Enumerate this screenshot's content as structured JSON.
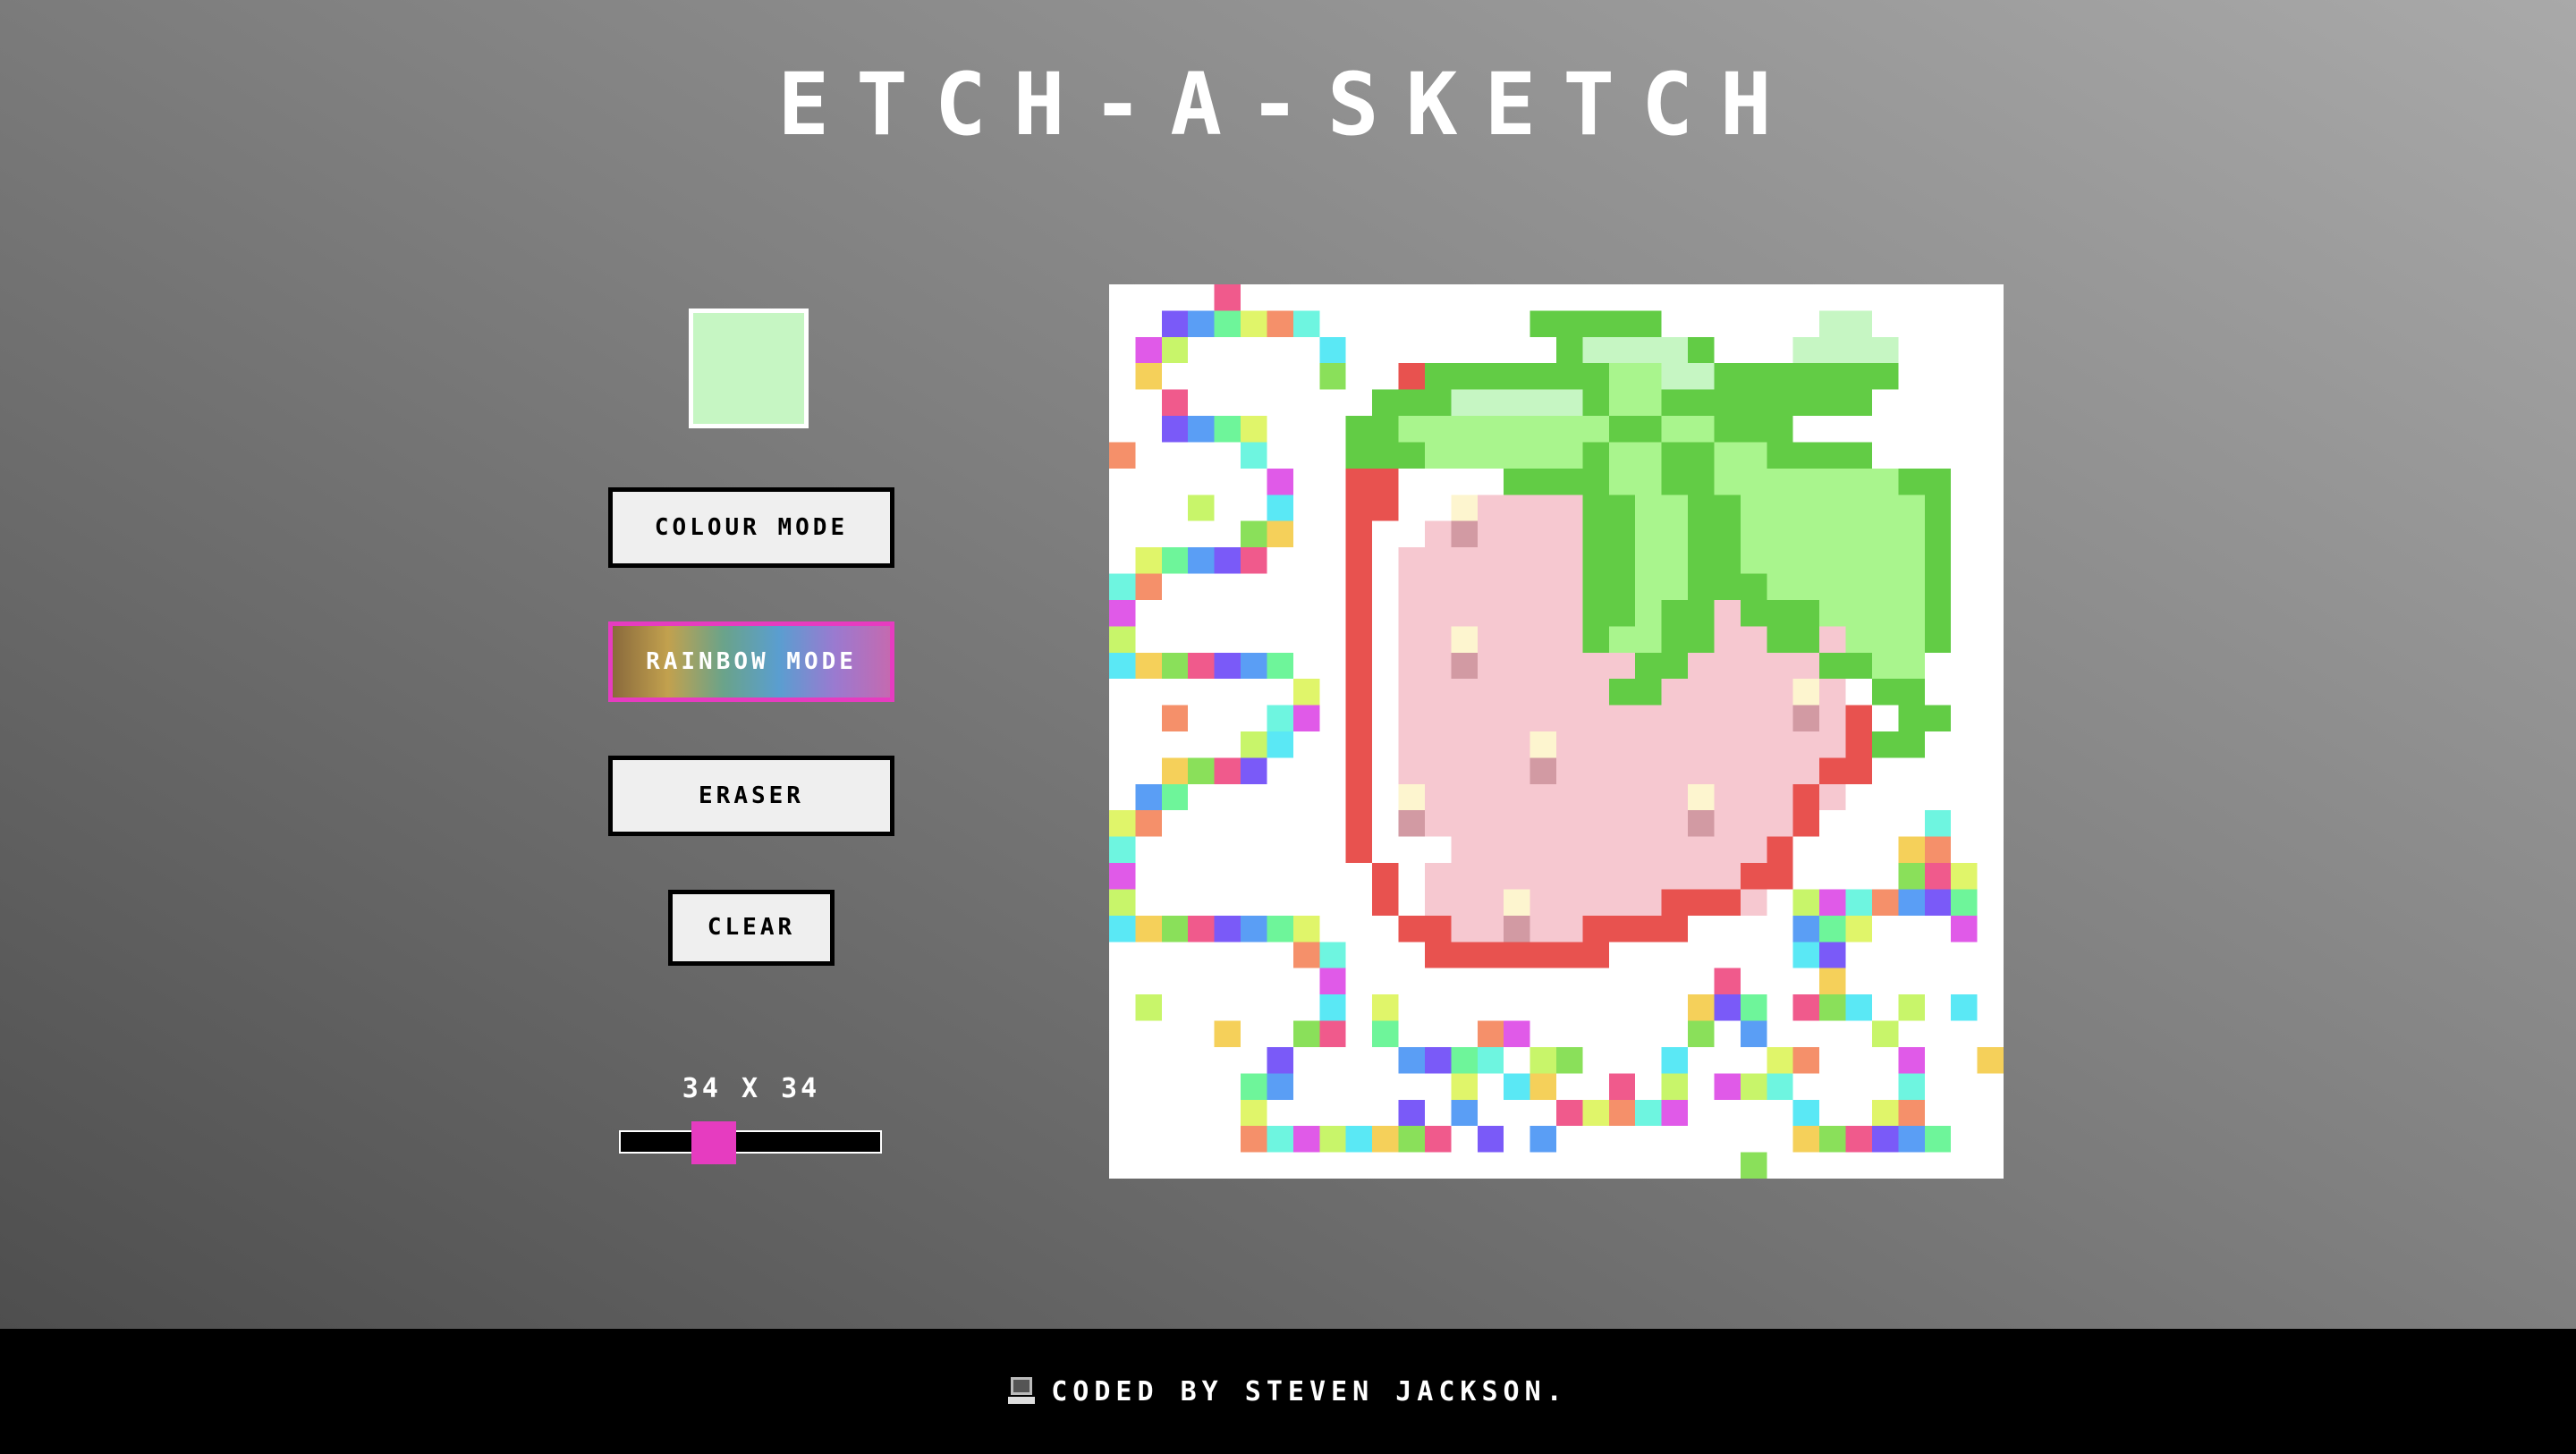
{
  "title": "ETCH-A-SKETCH",
  "current_colour": "#c6f6c3",
  "buttons": {
    "colour_mode": "COLOUR MODE",
    "rainbow_mode": "RAINBOW MODE",
    "eraser": "ERASER",
    "clear": "CLEAR"
  },
  "grid_size": {
    "label": "34 X 34",
    "value": 34,
    "min": 1,
    "max": 100
  },
  "accent_color": "#e63cc0",
  "footer": {
    "icon": "laptop-icon",
    "text": "CODED BY STEVEN JACKSON."
  }
}
